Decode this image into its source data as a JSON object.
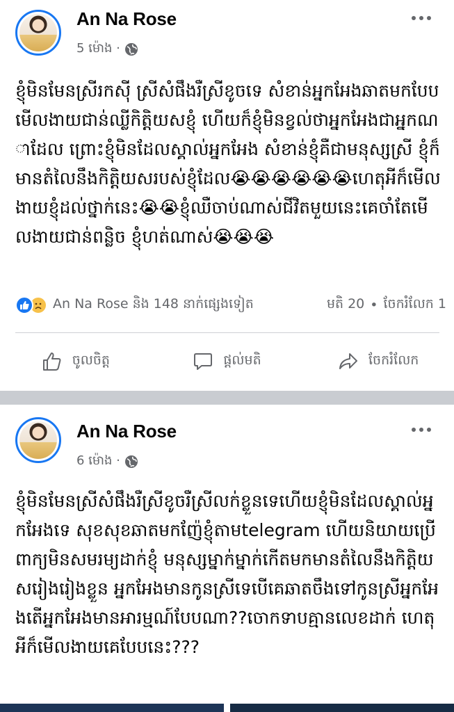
{
  "posts": [
    {
      "author": "An Na Rose",
      "time": "5 ម៉ោង ·",
      "privacy_icon": "globe-icon",
      "text": "ខ្ញុំមិនមែនស្រីរកស៊ី ស្រីសំផឹងរឺស្រីខូចទេ សំខាន់អ្នកអែងឆាតមកបែបមើលងាយជាន់ឈ្លីកិត្តិយសខ្ញុំ ហើយក៏ខ្ញុំមិនខ្វល់ថាអ្នកអែងជាអ្នកណាដែល ព្រោះខ្ញុំមិនដែលស្គាល់អ្នកអែង សំខាន់ខ្ញុំគឺជាមនុស្សស្រី ខ្ញុំក៏មានតំលៃនឹងកិត្តិយសរបស់ខ្ញុំដែល😭😭😭😭😭😭ហេតុអីក៏មើលងាយខ្ញុំដល់ថ្នាក់នេះ😭😭ខ្ញុំឈឺចាប់ណាស់ជីវិតមួយនេះគេចាំតែមើលងាយជាន់ពន្លិច ខ្ញុំហត់ណាស់😭😭😭",
      "reactions": {
        "summary": "An Na Rose និង 148 នាក់ផ្សេងទៀត",
        "comments": "មតិ 20",
        "separator": "•",
        "shares": "ចែករំលែក 1"
      },
      "actions": {
        "like": "ចូលចិត្ត",
        "comment": "ផ្ដល់មតិ",
        "share": "ចែករំលែក"
      }
    },
    {
      "author": "An Na Rose",
      "time": "6 ម៉ោង ·",
      "privacy_icon": "globe-icon",
      "text": "ខ្ញុំមិនមែនស្រីសំផឹងរឺស្រីខូចរឺស្រីលក់ខ្លួនទេហើយខ្ញុំមិនដែលស្គាល់អ្នកអែងទេ សុខសុខឆាតមកញ៉ែខ្ញុំតាមtelegram ហើយនិយាយប្រើពាក្យមិនសមរម្យដាក់ខ្ញុំ មនុស្សម្នាក់ម្នាក់កើតមកមានតំលៃនឹងកិត្តិយសរៀងរៀងខ្លួន អ្នកអែងមានកូនស្រីទេបើគេឆាតចឹងទៅកូនស្រីអ្នកអែងតើអ្នកអែងមានអារម្មណ៍បែបណា??ចោកទាបគ្មានលេខដាក់ ហេតុអីក៏មើលងាយគេបែបនេះ???"
    }
  ],
  "colors": {
    "accent": "#1877f2",
    "secondary_text": "#65676b",
    "separator": "#c9ccd1"
  }
}
